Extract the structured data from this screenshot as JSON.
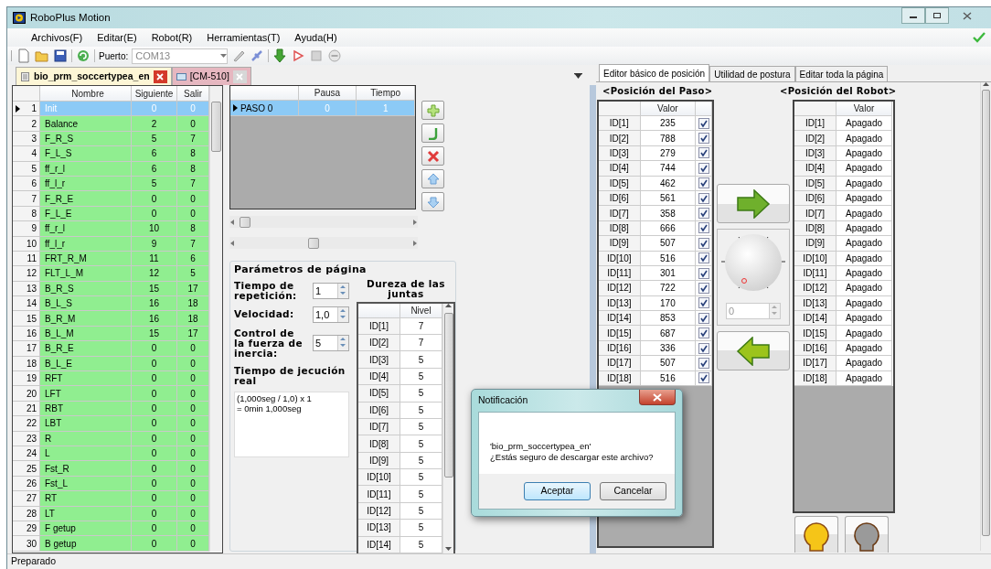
{
  "window": {
    "title": "RoboPlus Motion"
  },
  "menu": [
    "Archivos(F)",
    "Editar(E)",
    "Robot(R)",
    "Herramientas(T)",
    "Ayuda(H)"
  ],
  "toolbar": {
    "port_label": "Puerto:",
    "port_value": "COM13"
  },
  "doc_tabs": [
    {
      "label": "bio_prm_soccertypea_en",
      "selected": true
    },
    {
      "label": "[CM-510]",
      "selected": false
    }
  ],
  "motion_table": {
    "columns": [
      "Nombre",
      "Siguiente",
      "Salir"
    ],
    "rows": [
      {
        "num": "1",
        "name": "Init",
        "next": "0",
        "exit": "0",
        "selected": true
      },
      {
        "num": "2",
        "name": "Balance",
        "next": "2",
        "exit": "0",
        "selected": false
      },
      {
        "num": "3",
        "name": "F_R_S",
        "next": "5",
        "exit": "7",
        "selected": false
      },
      {
        "num": "4",
        "name": "F_L_S",
        "next": "6",
        "exit": "8",
        "selected": false
      },
      {
        "num": "5",
        "name": "ff_r_l",
        "next": "6",
        "exit": "8",
        "selected": false
      },
      {
        "num": "6",
        "name": "ff_l_r",
        "next": "5",
        "exit": "7",
        "selected": false
      },
      {
        "num": "7",
        "name": "F_R_E",
        "next": "0",
        "exit": "0",
        "selected": false
      },
      {
        "num": "8",
        "name": "F_L_E",
        "next": "0",
        "exit": "0",
        "selected": false
      },
      {
        "num": "9",
        "name": "ff_r_l",
        "next": "10",
        "exit": "8",
        "selected": false
      },
      {
        "num": "10",
        "name": "ff_l_r",
        "next": "9",
        "exit": "7",
        "selected": false
      },
      {
        "num": "11",
        "name": "FRT_R_M",
        "next": "11",
        "exit": "6",
        "selected": false
      },
      {
        "num": "12",
        "name": "FLT_L_M",
        "next": "12",
        "exit": "5",
        "selected": false
      },
      {
        "num": "13",
        "name": "B_R_S",
        "next": "15",
        "exit": "17",
        "selected": false
      },
      {
        "num": "14",
        "name": "B_L_S",
        "next": "16",
        "exit": "18",
        "selected": false
      },
      {
        "num": "15",
        "name": "B_R_M",
        "next": "16",
        "exit": "18",
        "selected": false
      },
      {
        "num": "16",
        "name": "B_L_M",
        "next": "15",
        "exit": "17",
        "selected": false
      },
      {
        "num": "17",
        "name": "B_R_E",
        "next": "0",
        "exit": "0",
        "selected": false
      },
      {
        "num": "18",
        "name": "B_L_E",
        "next": "0",
        "exit": "0",
        "selected": false
      },
      {
        "num": "19",
        "name": "RFT",
        "next": "0",
        "exit": "0",
        "selected": false
      },
      {
        "num": "20",
        "name": "LFT",
        "next": "0",
        "exit": "0",
        "selected": false
      },
      {
        "num": "21",
        "name": "RBT",
        "next": "0",
        "exit": "0",
        "selected": false
      },
      {
        "num": "22",
        "name": "LBT",
        "next": "0",
        "exit": "0",
        "selected": false
      },
      {
        "num": "23",
        "name": "R",
        "next": "0",
        "exit": "0",
        "selected": false
      },
      {
        "num": "24",
        "name": "L",
        "next": "0",
        "exit": "0",
        "selected": false
      },
      {
        "num": "25",
        "name": "Fst_R",
        "next": "0",
        "exit": "0",
        "selected": false
      },
      {
        "num": "26",
        "name": "Fst_L",
        "next": "0",
        "exit": "0",
        "selected": false
      },
      {
        "num": "27",
        "name": "RT",
        "next": "0",
        "exit": "0",
        "selected": false
      },
      {
        "num": "28",
        "name": "LT",
        "next": "0",
        "exit": "0",
        "selected": false
      },
      {
        "num": "29",
        "name": "F getup",
        "next": "0",
        "exit": "0",
        "selected": false
      },
      {
        "num": "30",
        "name": "B getup",
        "next": "0",
        "exit": "0",
        "selected": false
      }
    ]
  },
  "step_table": {
    "columns": [
      "Pausa",
      "Tiempo"
    ],
    "rows": [
      {
        "name": "PASO 0",
        "pause": "0",
        "time": "1",
        "selected": true
      }
    ]
  },
  "page_params": {
    "title": "Parámetros de página",
    "fields": [
      {
        "label": "Tiempo de repetición:",
        "value": "1"
      },
      {
        "label": "Velocidad:",
        "value": "1,0"
      },
      {
        "label": "Control de la fuerza de inercia:",
        "value": "5"
      }
    ],
    "exec_time": {
      "label": "Tiempo de jecución real",
      "text": "(1,000seg / 1,0) x 1\n= 0min 1,000seg"
    }
  },
  "stiffness": {
    "title": "Dureza de las juntas",
    "column": "Nivel",
    "rows": [
      {
        "id": "ID[1]",
        "value": "7"
      },
      {
        "id": "ID[2]",
        "value": "7"
      },
      {
        "id": "ID[3]",
        "value": "5"
      },
      {
        "id": "ID[4]",
        "value": "5"
      },
      {
        "id": "ID[5]",
        "value": "5"
      },
      {
        "id": "ID[6]",
        "value": "5"
      },
      {
        "id": "ID[7]",
        "value": "5"
      },
      {
        "id": "ID[8]",
        "value": "5"
      },
      {
        "id": "ID[9]",
        "value": "5"
      },
      {
        "id": "ID[10]",
        "value": "5"
      },
      {
        "id": "ID[11]",
        "value": "5"
      },
      {
        "id": "ID[12]",
        "value": "5"
      },
      {
        "id": "ID[13]",
        "value": "5"
      },
      {
        "id": "ID[14]",
        "value": "5"
      }
    ]
  },
  "right_tabs": [
    {
      "label": "Editor básico de posición",
      "selected": true
    },
    {
      "label": "Utilidad de postura",
      "selected": false
    },
    {
      "label": "Editar toda la página",
      "selected": false
    }
  ],
  "step_position": {
    "title": "<Posición del Paso>",
    "column": "Valor",
    "rows": [
      {
        "id": "ID[1]",
        "value": "235",
        "checked": true
      },
      {
        "id": "ID[2]",
        "value": "788",
        "checked": true
      },
      {
        "id": "ID[3]",
        "value": "279",
        "checked": true
      },
      {
        "id": "ID[4]",
        "value": "744",
        "checked": true
      },
      {
        "id": "ID[5]",
        "value": "462",
        "checked": true
      },
      {
        "id": "ID[6]",
        "value": "561",
        "checked": true
      },
      {
        "id": "ID[7]",
        "value": "358",
        "checked": true
      },
      {
        "id": "ID[8]",
        "value": "666",
        "checked": true
      },
      {
        "id": "ID[9]",
        "value": "507",
        "checked": true
      },
      {
        "id": "ID[10]",
        "value": "516",
        "checked": true
      },
      {
        "id": "ID[11]",
        "value": "301",
        "checked": true
      },
      {
        "id": "ID[12]",
        "value": "722",
        "checked": true
      },
      {
        "id": "ID[13]",
        "value": "170",
        "checked": true
      },
      {
        "id": "ID[14]",
        "value": "853",
        "checked": true
      },
      {
        "id": "ID[15]",
        "value": "687",
        "checked": true
      },
      {
        "id": "ID[16]",
        "value": "336",
        "checked": true
      },
      {
        "id": "ID[17]",
        "value": "507",
        "checked": true
      },
      {
        "id": "ID[18]",
        "value": "516",
        "checked": true
      }
    ]
  },
  "dial": {
    "value": "0",
    "disabled": true
  },
  "robot_position": {
    "title": "<Posición del Robot>",
    "column": "Valor",
    "rows": [
      {
        "id": "ID[1]",
        "value": "Apagado"
      },
      {
        "id": "ID[2]",
        "value": "Apagado"
      },
      {
        "id": "ID[3]",
        "value": "Apagado"
      },
      {
        "id": "ID[4]",
        "value": "Apagado"
      },
      {
        "id": "ID[5]",
        "value": "Apagado"
      },
      {
        "id": "ID[6]",
        "value": "Apagado"
      },
      {
        "id": "ID[7]",
        "value": "Apagado"
      },
      {
        "id": "ID[8]",
        "value": "Apagado"
      },
      {
        "id": "ID[9]",
        "value": "Apagado"
      },
      {
        "id": "ID[10]",
        "value": "Apagado"
      },
      {
        "id": "ID[11]",
        "value": "Apagado"
      },
      {
        "id": "ID[12]",
        "value": "Apagado"
      },
      {
        "id": "ID[13]",
        "value": "Apagado"
      },
      {
        "id": "ID[14]",
        "value": "Apagado"
      },
      {
        "id": "ID[15]",
        "value": "Apagado"
      },
      {
        "id": "ID[16]",
        "value": "Apagado"
      },
      {
        "id": "ID[17]",
        "value": "Apagado"
      },
      {
        "id": "ID[18]",
        "value": "Apagado"
      }
    ]
  },
  "status_bar": "Preparado",
  "dialog": {
    "title": "Notificación",
    "message": "'bio_prm_soccertypea_en'\n¿Estás seguro de descargar este archivo?",
    "buttons": [
      {
        "label": "Aceptar",
        "default": true
      },
      {
        "label": "Cancelar",
        "default": false
      }
    ]
  }
}
